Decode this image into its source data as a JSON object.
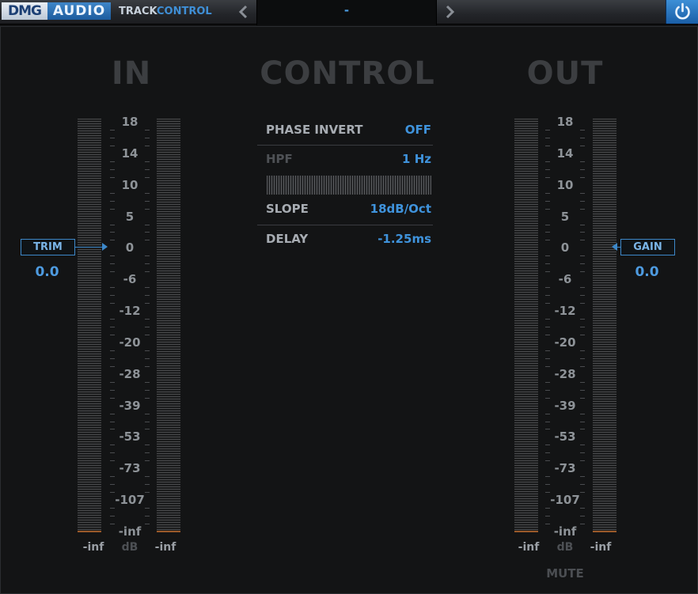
{
  "header": {
    "logo_dmg": "DMG",
    "logo_audio": "AUDIO",
    "product_part1": "TRACK",
    "product_part2": "CONTROL",
    "prev_icon": "chevron-left-icon",
    "next_icon": "chevron-right-icon",
    "preset_name": "-",
    "power_icon": "power-icon"
  },
  "sections": {
    "in": "IN",
    "control": "CONTROL",
    "out": "OUT"
  },
  "meter_scale": [
    "18",
    "14",
    "10",
    "5",
    "0",
    "-6",
    "-12",
    "-20",
    "-28",
    "-39",
    "-53",
    "-73",
    "-107",
    "-inf"
  ],
  "input": {
    "trim_label": "TRIM",
    "trim_value": "0.0",
    "left_readout": "-inf",
    "unit": "dB",
    "right_readout": "-inf"
  },
  "output": {
    "gain_label": "GAIN",
    "gain_value": "0.0",
    "left_readout": "-inf",
    "unit": "dB",
    "right_readout": "-inf",
    "mute_label": "MUTE"
  },
  "controls": {
    "phase_invert_label": "PHASE INVERT",
    "phase_invert_value": "OFF",
    "hpf_label": "HPF",
    "hpf_value": "1 Hz",
    "slope_label": "SLOPE",
    "slope_value": "18dB/Oct",
    "delay_label": "DELAY",
    "delay_value": "-1.25",
    "delay_unit": "ms"
  },
  "colors": {
    "accent": "#3f93dc",
    "title_dim": "#3c3e41",
    "background": "#131415"
  }
}
